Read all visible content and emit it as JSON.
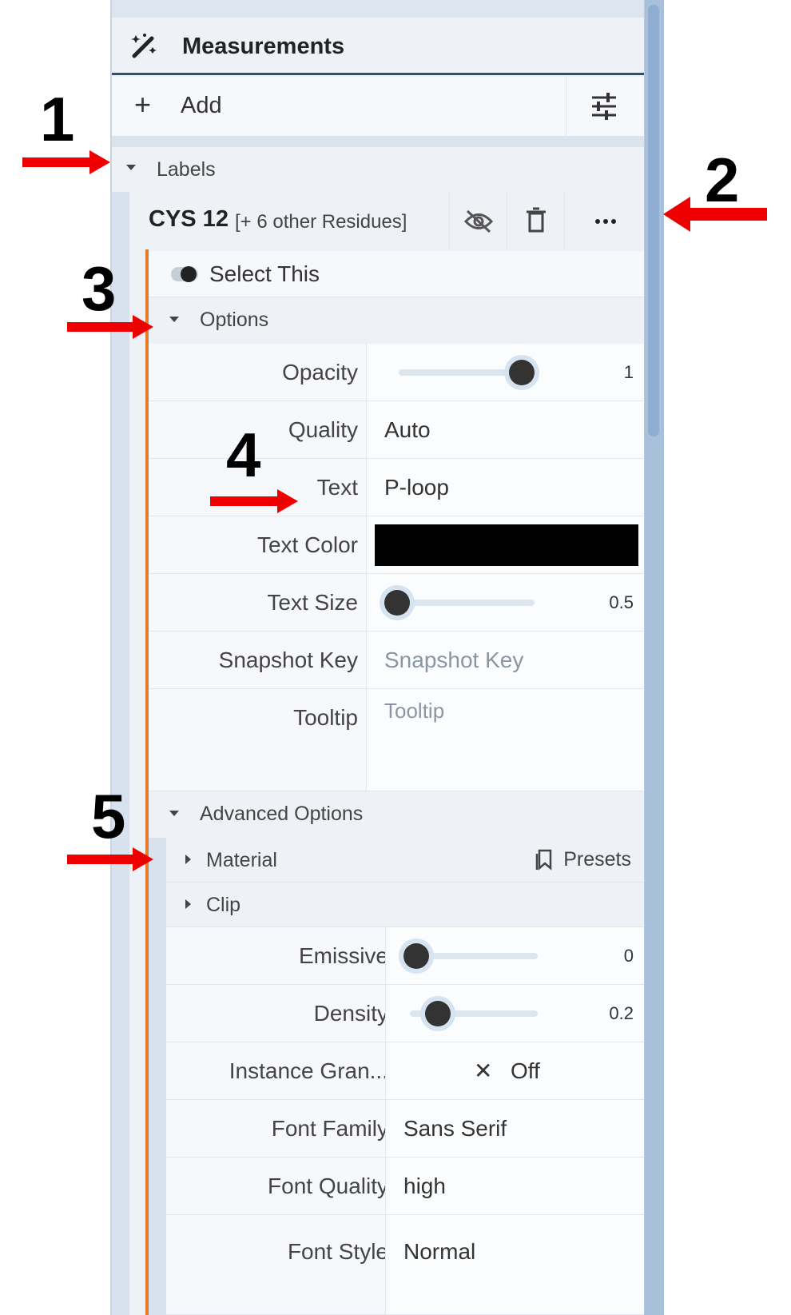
{
  "panel": {
    "title": "Measurements",
    "add_label": "Add",
    "labels_section": "Labels"
  },
  "item": {
    "name": "CYS 12",
    "extra": "[+ 6 other Residues]"
  },
  "select_this": "Select This",
  "options": {
    "header": "Options",
    "opacity": {
      "label": "Opacity",
      "value": "1",
      "level": 1.0
    },
    "quality": {
      "label": "Quality",
      "value": "Auto"
    },
    "text": {
      "label": "Text",
      "value": "P-loop"
    },
    "text_color": {
      "label": "Text Color",
      "color": "#000000"
    },
    "text_size": {
      "label": "Text Size",
      "value": "0.5",
      "level": 0.0
    },
    "snapshot_key": {
      "label": "Snapshot Key",
      "placeholder": "Snapshot Key"
    },
    "tooltip": {
      "label": "Tooltip",
      "placeholder": "Tooltip"
    }
  },
  "advanced": {
    "header": "Advanced Options",
    "material": "Material",
    "presets": "Presets",
    "clip": "Clip",
    "emissive": {
      "label": "Emissive",
      "value": "0",
      "level": 0.0
    },
    "density": {
      "label": "Density",
      "value": "0.2",
      "level": 0.15
    },
    "instance_granularity": {
      "label": "Instance Gran...",
      "value": "Off"
    },
    "font_family": {
      "label": "Font Family",
      "value": "Sans Serif"
    },
    "font_quality": {
      "label": "Font Quality",
      "value": "high"
    },
    "font_style": {
      "label": "Font Style",
      "value": "Normal"
    }
  },
  "annotations": [
    "1",
    "2",
    "3",
    "4",
    "5"
  ],
  "colors": {
    "accent_orange": "#e27b2c",
    "header_border": "#2e4f79",
    "arrow_red": "#ee0000"
  }
}
